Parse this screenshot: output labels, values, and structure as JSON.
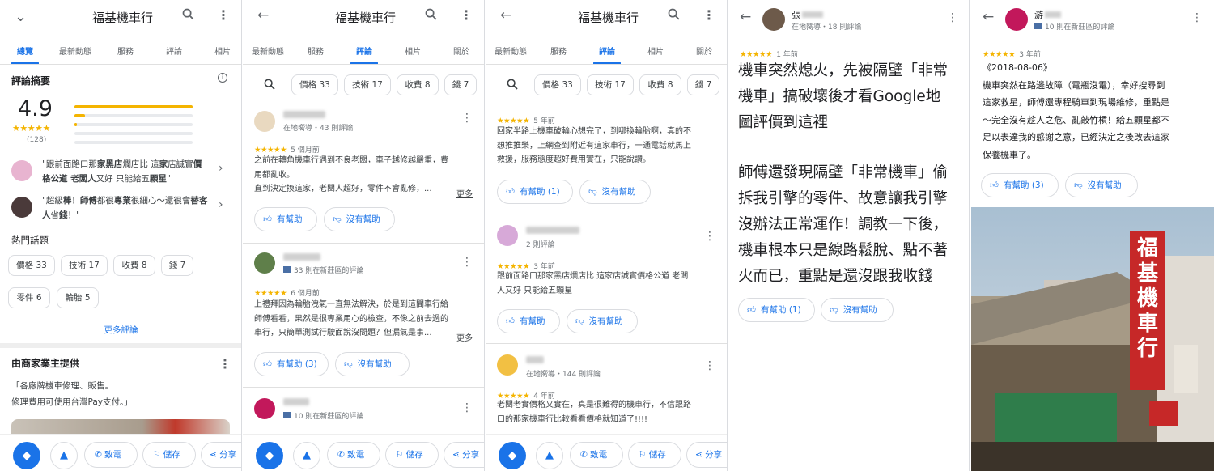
{
  "shop_name": "福基機車行",
  "p1": {
    "tabs": [
      "總覽",
      "最新動態",
      "服務",
      "評論",
      "相片"
    ],
    "summary_title": "評論摘要",
    "rating": "4.9",
    "stars": "★★★★★",
    "count": "(128)",
    "quote1_a": "\"跟前面路口那",
    "quote1_b": "家黑店",
    "quote1_c": "爛店比 這",
    "quote1_d": "家",
    "quote1_e": "店誠實",
    "quote1_f": "價格公道 老闆人",
    "quote1_g": "又好 只能給五",
    "quote1_h": "顆星",
    "quote1_i": "\"",
    "quote2_a": "\"超級",
    "quote2_b": "棒",
    "quote2_c": "！",
    "quote2_d": "師傅",
    "quote2_e": "都很",
    "quote2_f": "專業",
    "quote2_g": "很細心～還很會",
    "quote2_h": "替",
    "quote2_i": "客人",
    "quote2_j": "省",
    "quote2_k": "錢",
    "quote2_l": "！\"",
    "topics_title": "熱門話題",
    "topics": [
      "價格 33",
      "技術 17",
      "收費 8",
      "錢 7",
      "零件 6",
      "輪胎 5"
    ],
    "more_reviews": "更多評論",
    "owner_title": "由商家業主提供",
    "owner_text1": "「各廠牌機車修理、販售。",
    "owner_text2": "修理費用可使用台灣Pay支付。」"
  },
  "bottom": {
    "call": "致電",
    "save": "儲存",
    "share": "分享"
  },
  "p2": {
    "tabs": [
      "最新動態",
      "服務",
      "評論",
      "相片",
      "關於"
    ],
    "chips": [
      "價格 33",
      "技術 17",
      "收費 8",
      "錢 7"
    ],
    "r1": {
      "meta": "在地嚮導・43 則評論",
      "stars": "★★★★★",
      "time": "5 個月前",
      "text": [
        "之前在轉角機車行遇到不良老闆，車子越修越嚴重，費",
        "用都亂收。",
        "直到決定換這家，老闆人超好，零件不會亂修，..."
      ],
      "more": "更多",
      "helpful": "有幫助",
      "nothelpful": "沒有幫助"
    },
    "r2": {
      "meta": "33 則在新莊區的評論",
      "stars": "★★★★★",
      "time": "6 個月前",
      "text": [
        "上禮拜因為輪胎洩氣一直無法解決，於是到這間車行給",
        "師傅看看，果然是很專業用心的檢查，不像之前去過的",
        "車行，只簡單測試行駛面說沒問題？但漏氣是事..."
      ],
      "more": "更多",
      "helpful": "有幫助 (3)",
      "nothelpful": "沒有幫助"
    },
    "r3": {
      "meta": "10 則在新莊區的評論"
    }
  },
  "p3": {
    "tabs": [
      "最新動態",
      "服務",
      "評論",
      "相片",
      "關於"
    ],
    "chips": [
      "價格 33",
      "技術 17",
      "收費 8",
      "錢 7"
    ],
    "r0": {
      "stars": "★★★★★",
      "time": "5 年前",
      "text": [
        "回家半路上機車破輪心想完了，到哪換輪胎啊，真的不",
        "想推推樂，上網查到附近有這家車行，一通電話就馬上",
        "救援，服務態度超好費用實在，只能說讚。"
      ],
      "helpful": "有幫助 (1)",
      "nothelpful": "沒有幫助"
    },
    "r1": {
      "meta": "2 則評論",
      "stars": "★★★★★",
      "time": "3 年前",
      "text": [
        "跟前面路口那家黑店爛店比  這家店誠實價格公道 老闆",
        "人又好 只能給五顆星"
      ],
      "helpful": "有幫助",
      "nothelpful": "沒有幫助"
    },
    "r2": {
      "meta": "在地嚮導・144 則評論",
      "stars": "★★★★★",
      "time": "4 年前",
      "text": [
        "老闆老實價格又實在，真是很難得的機車行，不信跟路",
        "口的那家機車行比較看看價格就知道了!!!!"
      ]
    }
  },
  "p4": {
    "name": "張",
    "meta": "在地嚮導・18 則評論",
    "stars": "★★★★★",
    "time": "1 年前",
    "text": [
      "機車突然熄火，先被隔壁「非常",
      "機車」搞破壞後才看Google地",
      "圖評價到這裡",
      "",
      "師傅還發現隔壁「非常機車」偷",
      "拆我引擎的零件、故意讓我引擎",
      "沒辦法正常運作！調教一下後，",
      "機車根本只是線路鬆脫、點不著",
      "火而已，重點是還沒跟我收錢"
    ],
    "helpful": "有幫助 (1)",
    "nothelpful": "沒有幫助"
  },
  "p5": {
    "name": "游",
    "meta": "10 則在新莊區的評論",
    "stars": "★★★★★",
    "time": "3 年前",
    "text": [
      "《2018-08-06》",
      "機車突然在路邊故障（電瓶沒電），幸好搜尋到",
      "這家救星，師傅還專程騎車到現場維修，重點是",
      "～完全沒有趁人之危、亂敲竹槓！給五顆星都不",
      "足以表達我的感謝之意，已經決定之後改去這家",
      "保養機車了。"
    ],
    "helpful": "有幫助 (3)",
    "nothelpful": "沒有幫助",
    "sign": "福基機車行"
  },
  "colors": {
    "accent": "#1a73e8",
    "star": "#f4b400",
    "text": "#202124",
    "sub": "#70757a"
  }
}
